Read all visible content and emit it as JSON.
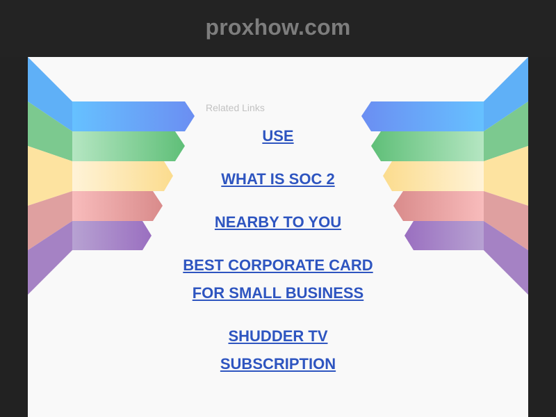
{
  "header": {
    "site_title": "proxhow.com"
  },
  "main": {
    "related_label": "Related Links",
    "links": [
      {
        "label": "USE"
      },
      {
        "label": "WHAT IS SOC 2"
      },
      {
        "label": "NEARBY TO YOU"
      },
      {
        "label": "BEST CORPORATE CARD FOR SMALL BUSINESS"
      },
      {
        "label": "SHUDDER TV SUBSCRIPTION"
      }
    ]
  },
  "colors": {
    "background": "#222222",
    "panel": "#f9f9f9",
    "title": "#7d7d7d",
    "link": "#2e55c0",
    "ribbon_blue": "#5aa9f5",
    "ribbon_green": "#6ec585",
    "ribbon_yellow": "#fbe3a4",
    "ribbon_red": "#e0a1a1",
    "ribbon_purple": "#a07cc0"
  }
}
